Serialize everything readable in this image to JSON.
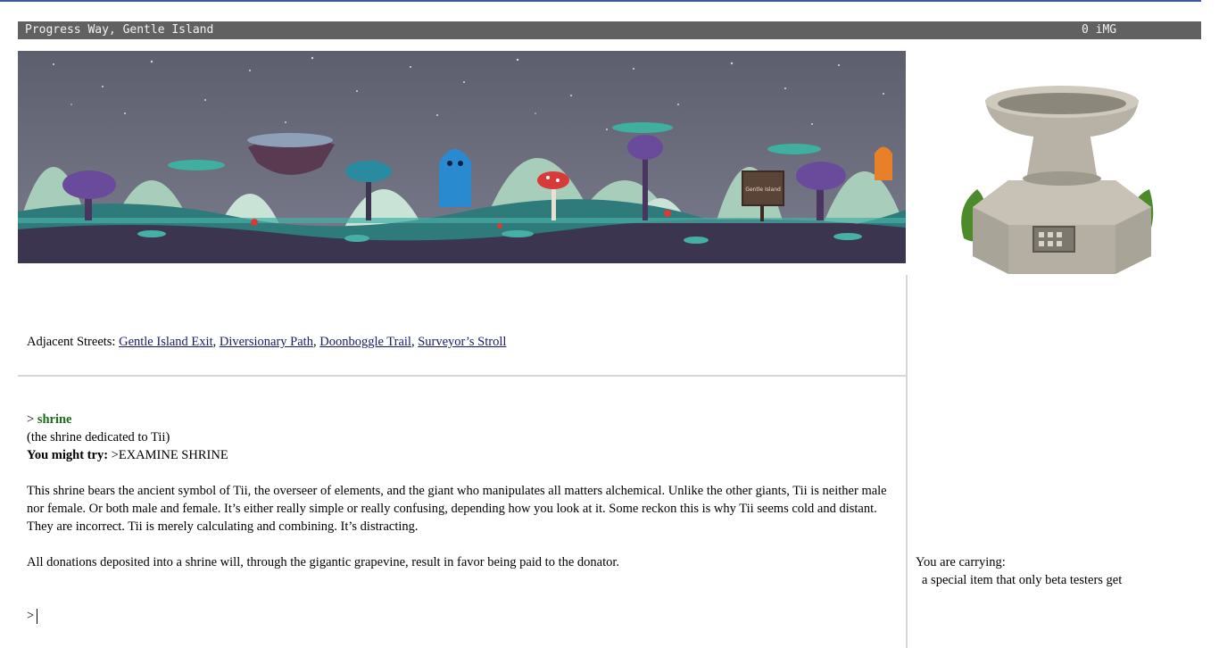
{
  "status_bar": {
    "location": "Progress Way, Gentle Island",
    "currency": "0 iMG"
  },
  "banner": {
    "sign_text": "Gentle Island"
  },
  "adjacent": {
    "label": "Adjacent Streets:",
    "streets": [
      "Gentle Island Exit",
      "Diversionary Path",
      "Doonboggle Trail",
      "Surveyor’s Stroll"
    ],
    "separator": ", "
  },
  "output": {
    "prompt_char": ">",
    "command": "shrine",
    "subtitle": "(the shrine dedicated to Tii)",
    "try_label": "You might try:",
    "try_value": ">EXAMINE SHRINE",
    "paragraph1": "This shrine bears the ancient symbol of Tii, the overseer of elements, and the giant who manipulates all matters alchemical. Unlike the other giants, Tii is neither male nor female. Or both male and female. It’s either really simple or really confusing, depending how you look at it. Some reckon this is why Tii seems cold and distant. They are incorrect. Tii is merely calculating and combining. It’s distracting.",
    "paragraph2": "All donations deposited into a shrine will, through the gigantic grapevine, result in favor being paid to the donator."
  },
  "input": {
    "prompt_char": ">",
    "value": ""
  },
  "inventory": {
    "label": "You are carrying:",
    "items": [
      "a special item that only beta testers get"
    ]
  },
  "colors": {
    "status_bar_bg": "#616161",
    "link": "#1a1a6e",
    "command_green": "#1b6b1b"
  }
}
